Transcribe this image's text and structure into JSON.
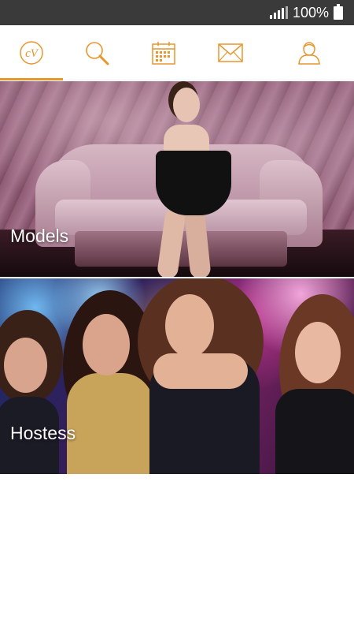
{
  "status_bar": {
    "battery_text": "100%",
    "icons": [
      "signal-icon",
      "battery-icon"
    ]
  },
  "tabs": [
    {
      "name": "logo",
      "icon": "cv-logo-icon",
      "active": true
    },
    {
      "name": "search",
      "icon": "search-icon",
      "active": false
    },
    {
      "name": "calendar",
      "icon": "calendar-icon",
      "active": false
    },
    {
      "name": "messages",
      "icon": "envelope-icon",
      "active": false
    },
    {
      "name": "profile",
      "icon": "user-icon",
      "active": false
    }
  ],
  "accent_color": "#e8962c",
  "categories": [
    {
      "label": "Models"
    },
    {
      "label": "Hostess"
    }
  ]
}
